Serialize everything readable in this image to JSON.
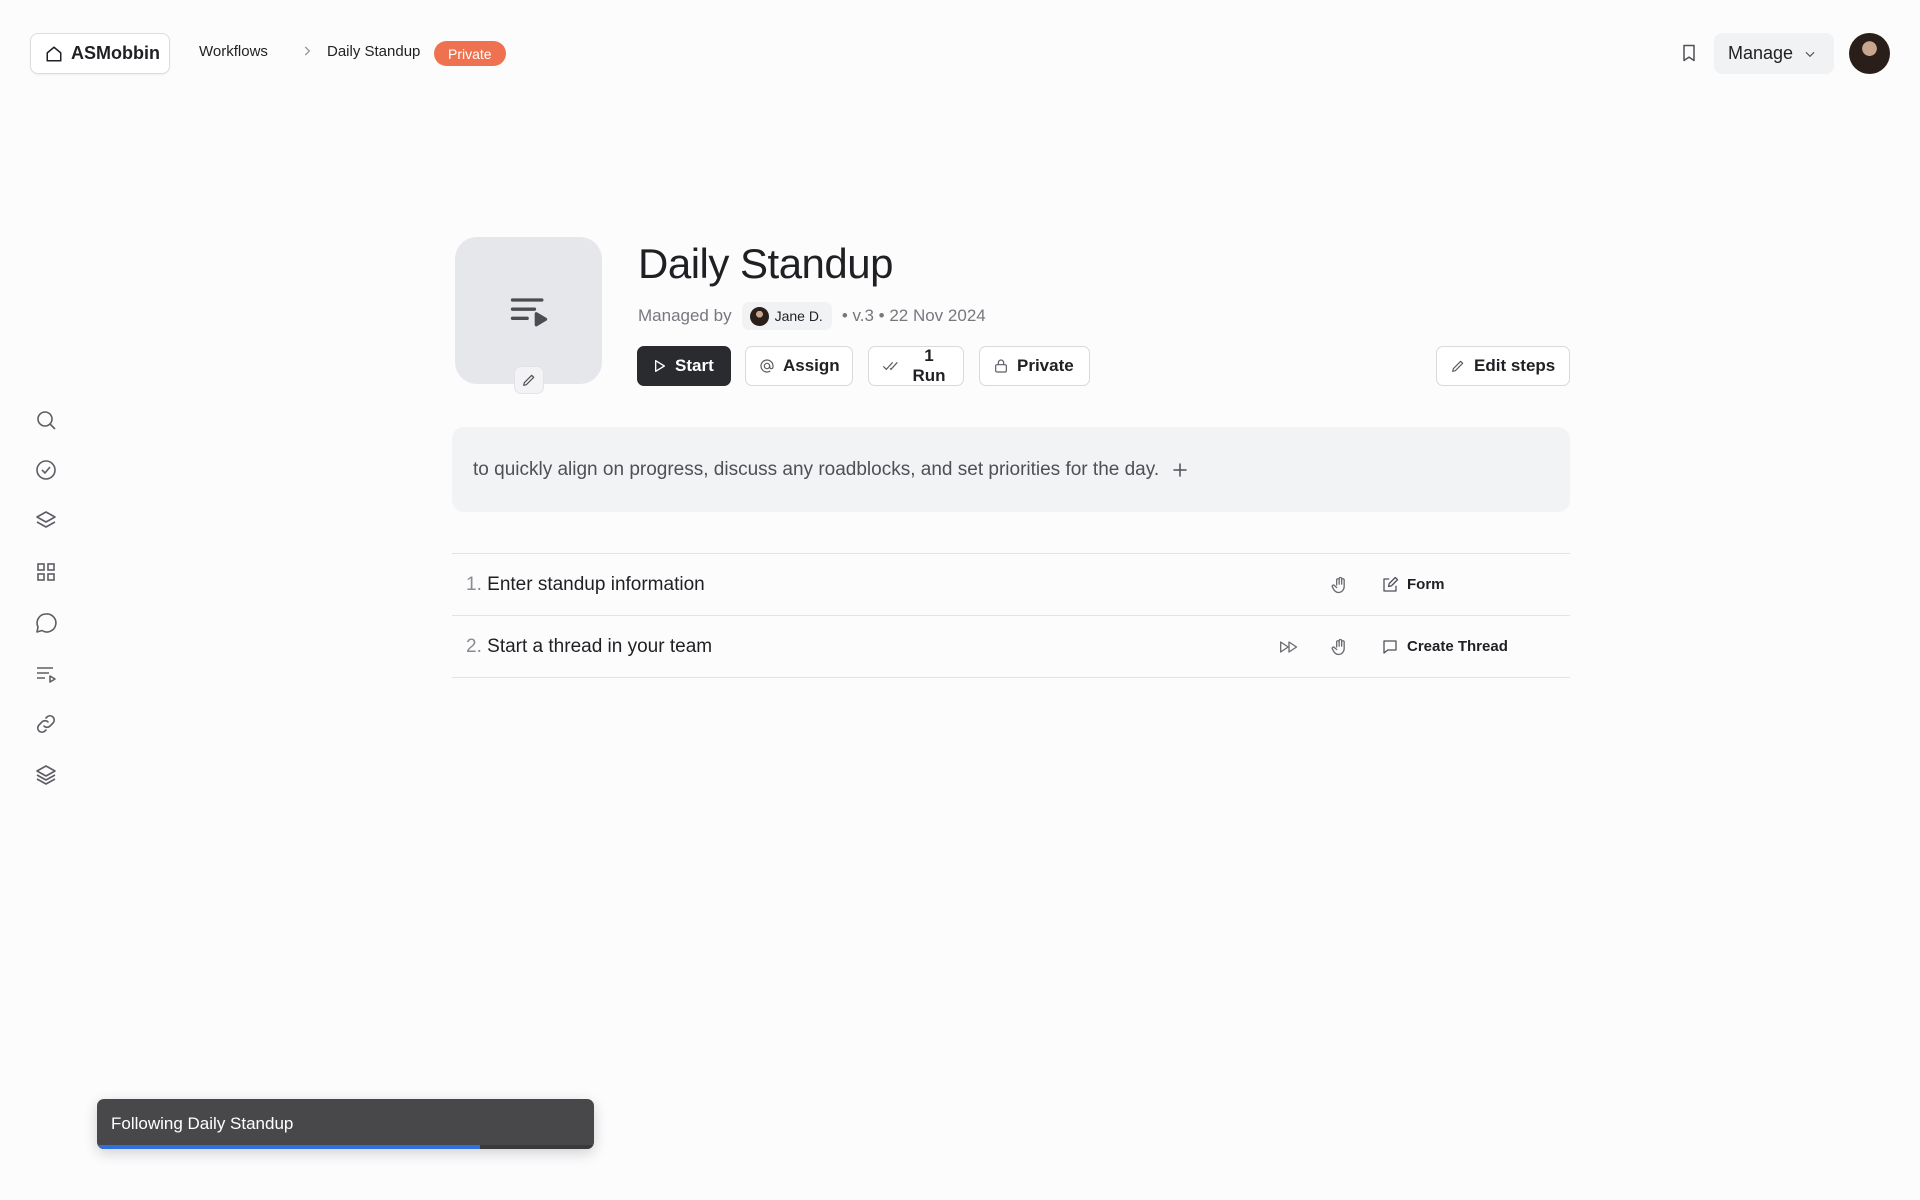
{
  "app": {
    "name": "ASMobbin"
  },
  "breadcrumb": {
    "workflows": "Workflows",
    "current": "Daily Standup",
    "badge": "Private"
  },
  "header": {
    "manage_label": "Manage",
    "bookmark_icon": "bookmark-icon",
    "user_avatar": "avatar"
  },
  "rail": {
    "items": [
      {
        "icon": "search-icon"
      },
      {
        "icon": "check-circle-icon"
      },
      {
        "icon": "layers-icon"
      },
      {
        "icon": "grid-icon"
      },
      {
        "icon": "chat-icon"
      },
      {
        "icon": "playlist-icon"
      },
      {
        "icon": "link-icon"
      },
      {
        "icon": "layers-icon"
      }
    ]
  },
  "workflow": {
    "title": "Daily Standup",
    "managed_by_label": "Managed by",
    "manager": "Jane D.",
    "version": "• v.3 • 22 Nov 2024",
    "buttons": {
      "start": "Start",
      "assign": "Assign",
      "runs": "1 Run",
      "private": "Private",
      "edit_steps": "Edit steps"
    },
    "description": "to quickly align on progress, discuss any roadblocks, and set priorities for the day."
  },
  "steps": [
    {
      "number": "1.",
      "title": "Enter standup information",
      "action": "Form"
    },
    {
      "number": "2.",
      "title": "Start a thread in your team",
      "action": "Create Thread"
    }
  ],
  "toast": {
    "message": "Following Daily Standup",
    "progress": 0.77
  },
  "colors": {
    "badge": "#ef7250",
    "primary_button": "#2a2b2f",
    "toast_progress": "#2f6fde"
  }
}
